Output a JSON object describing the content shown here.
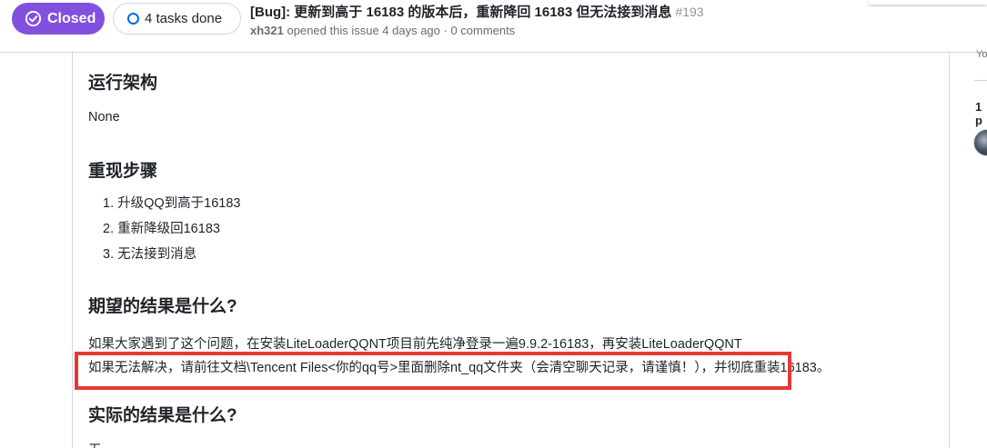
{
  "header": {
    "status_label": "Closed",
    "tasks_label": "4 tasks done",
    "title": "[Bug]: 更新到高于 16183 的版本后，重新降回 16183 但无法接到消息",
    "number": "#193",
    "author": "xh321",
    "meta_text": "opened this issue 4 days ago · 0 comments"
  },
  "body": {
    "section_arch_heading": "运行架构",
    "section_arch_value": "None",
    "section_repro_heading": "重现步骤",
    "steps": [
      "1. 升级QQ到高于16183",
      "2. 重新降级回16183",
      "3. 无法接到消息"
    ],
    "section_expected_heading": "期望的结果是什么?",
    "expected_line1": "如果大家遇到了这个问题，在安装LiteLoaderQQNT项目前先纯净登录一遍9.9.2-16183，再安装LiteLoaderQQNT",
    "expected_line2": "如果无法解决，请前往文档\\Tencent Files<你的qq号>里面删除nt_qq文件夹（会清空聊天记录，请谨慎！），并彻底重装16183。",
    "section_actual_heading": "实际的结果是什么?",
    "actual_value": "无"
  },
  "sidebar": {
    "truncated_label": "Yo",
    "participants_count": "1 p"
  },
  "colors": {
    "closed_purple": "#8250df",
    "highlight_red": "#e53935",
    "border_gray": "#d0d7de",
    "task_ring_blue": "#0969da"
  },
  "icons": [
    "check-circle-icon",
    "progress-ring-icon"
  ]
}
